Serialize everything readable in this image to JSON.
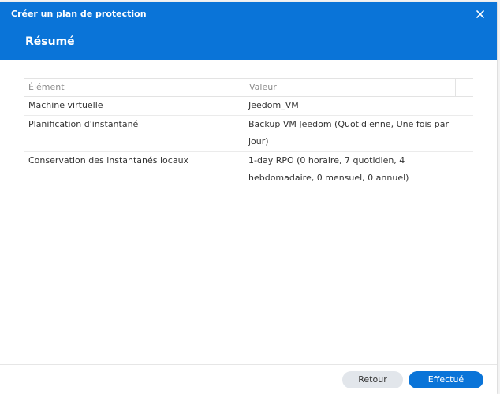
{
  "window": {
    "title": "Créer un plan de protection",
    "close_icon": "close-icon"
  },
  "section": {
    "title": "Résumé"
  },
  "table": {
    "columns": [
      "Élément",
      "Valeur"
    ],
    "rows": [
      {
        "name": "Machine virtuelle",
        "value": "Jeedom_VM"
      },
      {
        "name": "Planification d'instantané",
        "value": "Backup VM Jeedom (Quotidienne, Une fois par jour)"
      },
      {
        "name": "Conservation des instantanés locaux",
        "value": "1-day RPO (0 horaire, 7 quotidien, 4 hebdomadaire, 0 mensuel, 0 annuel)"
      }
    ]
  },
  "footer": {
    "back_label": "Retour",
    "done_label": "Effectué"
  },
  "colors": {
    "header": "#0a74d8",
    "primary_button": "#0a74d8",
    "secondary_button": "#e2e6eb"
  }
}
